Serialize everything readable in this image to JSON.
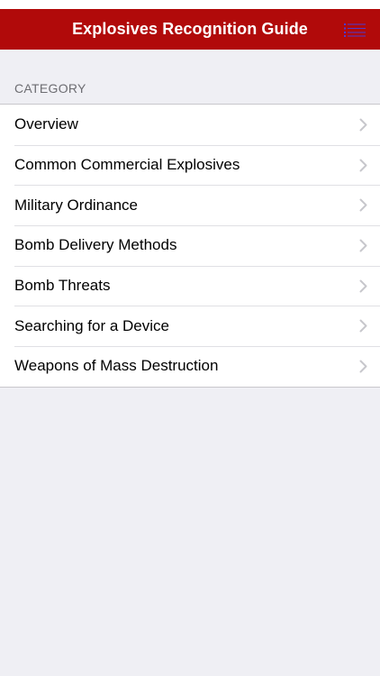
{
  "header": {
    "title": "Explosives Recognition Guide",
    "menu_icon": "list-icon"
  },
  "section": {
    "title": "CATEGORY"
  },
  "categories": [
    {
      "label": "Overview"
    },
    {
      "label": "Common Commercial Explosives"
    },
    {
      "label": "Military Ordinance"
    },
    {
      "label": "Bomb Delivery Methods"
    },
    {
      "label": "Bomb Threats"
    },
    {
      "label": "Searching for a Device"
    },
    {
      "label": "Weapons of Mass Destruction"
    }
  ],
  "colors": {
    "nav_background": "#b10a0a",
    "menu_icon": "#4a3bd1",
    "page_background": "#efeff4",
    "chevron": "#c7c7cc"
  }
}
